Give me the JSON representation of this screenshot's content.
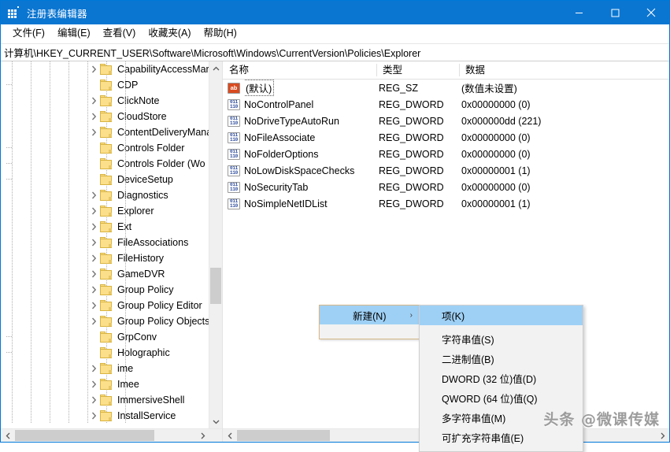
{
  "window": {
    "title": "注册表编辑器",
    "app_icon": "registry-icon",
    "accent_color": "#0b76d1",
    "controls": [
      {
        "name": "minimize",
        "glyph": "minimize-icon"
      },
      {
        "name": "maximize",
        "glyph": "maximize-icon"
      },
      {
        "name": "close",
        "glyph": "close-icon"
      }
    ]
  },
  "menubar": {
    "items": [
      {
        "label": "文件(F)"
      },
      {
        "label": "编辑(E)"
      },
      {
        "label": "查看(V)"
      },
      {
        "label": "收藏夹(A)"
      },
      {
        "label": "帮助(H)"
      }
    ]
  },
  "address": {
    "path": "计算机\\HKEY_CURRENT_USER\\Software\\Microsoft\\Windows\\CurrentVersion\\Policies\\Explorer"
  },
  "tree": {
    "items": [
      {
        "label": "CapabilityAccessMar",
        "expandable": true
      },
      {
        "label": "CDP",
        "expandable": false
      },
      {
        "label": "ClickNote",
        "expandable": true
      },
      {
        "label": "CloudStore",
        "expandable": true
      },
      {
        "label": "ContentDeliveryMana",
        "expandable": true
      },
      {
        "label": "Controls Folder",
        "expandable": false
      },
      {
        "label": "Controls Folder (Wo",
        "expandable": false
      },
      {
        "label": "DeviceSetup",
        "expandable": false
      },
      {
        "label": "Diagnostics",
        "expandable": true
      },
      {
        "label": "Explorer",
        "expandable": true
      },
      {
        "label": "Ext",
        "expandable": true
      },
      {
        "label": "FileAssociations",
        "expandable": true
      },
      {
        "label": "FileHistory",
        "expandable": true
      },
      {
        "label": "GameDVR",
        "expandable": true
      },
      {
        "label": "Group Policy",
        "expandable": true
      },
      {
        "label": "Group Policy Editor",
        "expandable": true
      },
      {
        "label": "Group Policy Objects",
        "expandable": true
      },
      {
        "label": "GrpConv",
        "expandable": false
      },
      {
        "label": "Holographic",
        "expandable": false
      },
      {
        "label": "ime",
        "expandable": true
      },
      {
        "label": "Imee",
        "expandable": true
      },
      {
        "label": "ImmersiveShell",
        "expandable": true
      },
      {
        "label": "InstallService",
        "expandable": true
      }
    ]
  },
  "list": {
    "columns": [
      {
        "label": "名称"
      },
      {
        "label": "类型"
      },
      {
        "label": "数据"
      }
    ],
    "rows": [
      {
        "icon": "string-value-icon",
        "kind": "sz",
        "name": "(默认)",
        "selected_name": true,
        "type": "REG_SZ",
        "data": "(数值未设置)"
      },
      {
        "icon": "dword-value-icon",
        "kind": "dw",
        "name": "NoControlPanel",
        "selected_name": false,
        "type": "REG_DWORD",
        "data": "0x00000000 (0)"
      },
      {
        "icon": "dword-value-icon",
        "kind": "dw",
        "name": "NoDriveTypeAutoRun",
        "selected_name": false,
        "type": "REG_DWORD",
        "data": "0x000000dd (221)"
      },
      {
        "icon": "dword-value-icon",
        "kind": "dw",
        "name": "NoFileAssociate",
        "selected_name": false,
        "type": "REG_DWORD",
        "data": "0x00000000 (0)"
      },
      {
        "icon": "dword-value-icon",
        "kind": "dw",
        "name": "NoFolderOptions",
        "selected_name": false,
        "type": "REG_DWORD",
        "data": "0x00000000 (0)"
      },
      {
        "icon": "dword-value-icon",
        "kind": "dw",
        "name": "NoLowDiskSpaceChecks",
        "selected_name": false,
        "type": "REG_DWORD",
        "data": "0x00000001 (1)"
      },
      {
        "icon": "dword-value-icon",
        "kind": "dw",
        "name": "NoSecurityTab",
        "selected_name": false,
        "type": "REG_DWORD",
        "data": "0x00000000 (0)"
      },
      {
        "icon": "dword-value-icon",
        "kind": "dw",
        "name": "NoSimpleNetIDList",
        "selected_name": false,
        "type": "REG_DWORD",
        "data": "0x00000001 (1)"
      }
    ]
  },
  "context_menu": {
    "new_label": "新建(N)",
    "submenu_arrow": "chevron-right-icon",
    "highlight_color": "#9ed0f5",
    "submenu": [
      {
        "label": "项(K)",
        "selected": true
      },
      {
        "label": "字符串值(S)",
        "selected": false
      },
      {
        "label": "二进制值(B)",
        "selected": false
      },
      {
        "label": "DWORD (32 位)值(D)",
        "selected": false
      },
      {
        "label": "QWORD (64 位)值(Q)",
        "selected": false
      },
      {
        "label": "多字符串值(M)",
        "selected": false
      },
      {
        "label": "可扩充字符串值(E)",
        "selected": false
      }
    ]
  },
  "watermark": {
    "text": "头条 @微课传媒"
  }
}
